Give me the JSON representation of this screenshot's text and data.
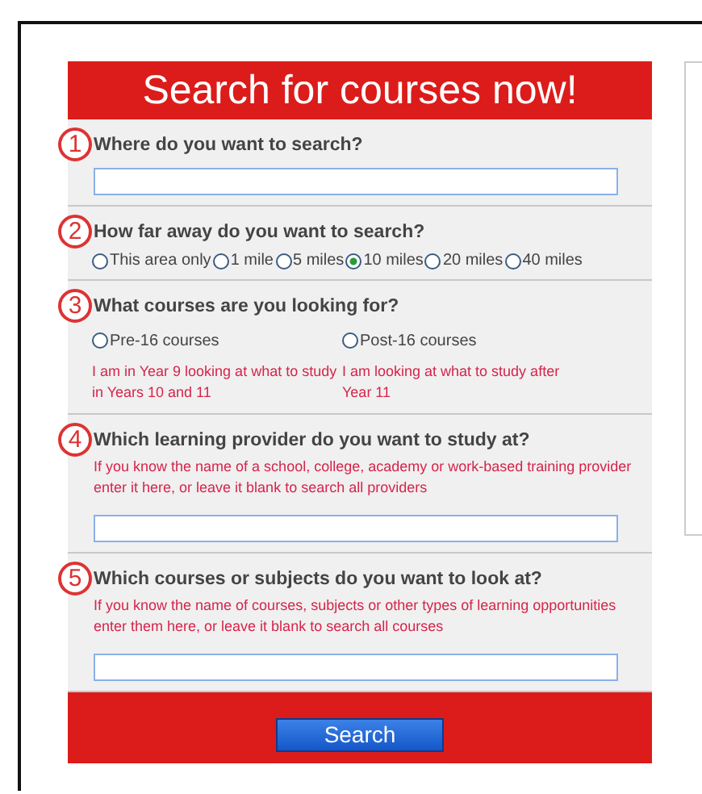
{
  "title": "Search for courses now!",
  "sections": [
    {
      "number": "1",
      "question": "Where do you want to search?",
      "kind": "text"
    },
    {
      "number": "2",
      "question": "How far away do you want to search?",
      "kind": "radios",
      "options": [
        {
          "label": "This area only",
          "selected": false
        },
        {
          "label": "1 mile",
          "selected": false
        },
        {
          "label": "5 miles",
          "selected": false
        },
        {
          "label": "10 miles",
          "selected": true
        },
        {
          "label": "20 miles",
          "selected": false
        },
        {
          "label": "40 miles",
          "selected": false
        }
      ]
    },
    {
      "number": "3",
      "question": "What courses are you looking for?",
      "kind": "choices",
      "options": [
        {
          "label": "Pre-16 courses",
          "description": "I am in Year 9 looking at what to study in Years 10 and 11",
          "selected": false
        },
        {
          "label": "Post-16 courses",
          "description": "I am looking at what to study after Year 11",
          "selected": false
        }
      ]
    },
    {
      "number": "4",
      "question": "Which learning provider do you want to study at?",
      "hint": "If you know the name of a school, college, academy or work-based training provider enter it here, or leave it blank to search all providers",
      "kind": "text"
    },
    {
      "number": "5",
      "question": "Which courses or subjects do you want to look at?",
      "hint": "If you know the name of courses, subjects or other types of learning opportunities enter them here, or leave it blank to search all courses",
      "kind": "text"
    }
  ],
  "button": "Search"
}
